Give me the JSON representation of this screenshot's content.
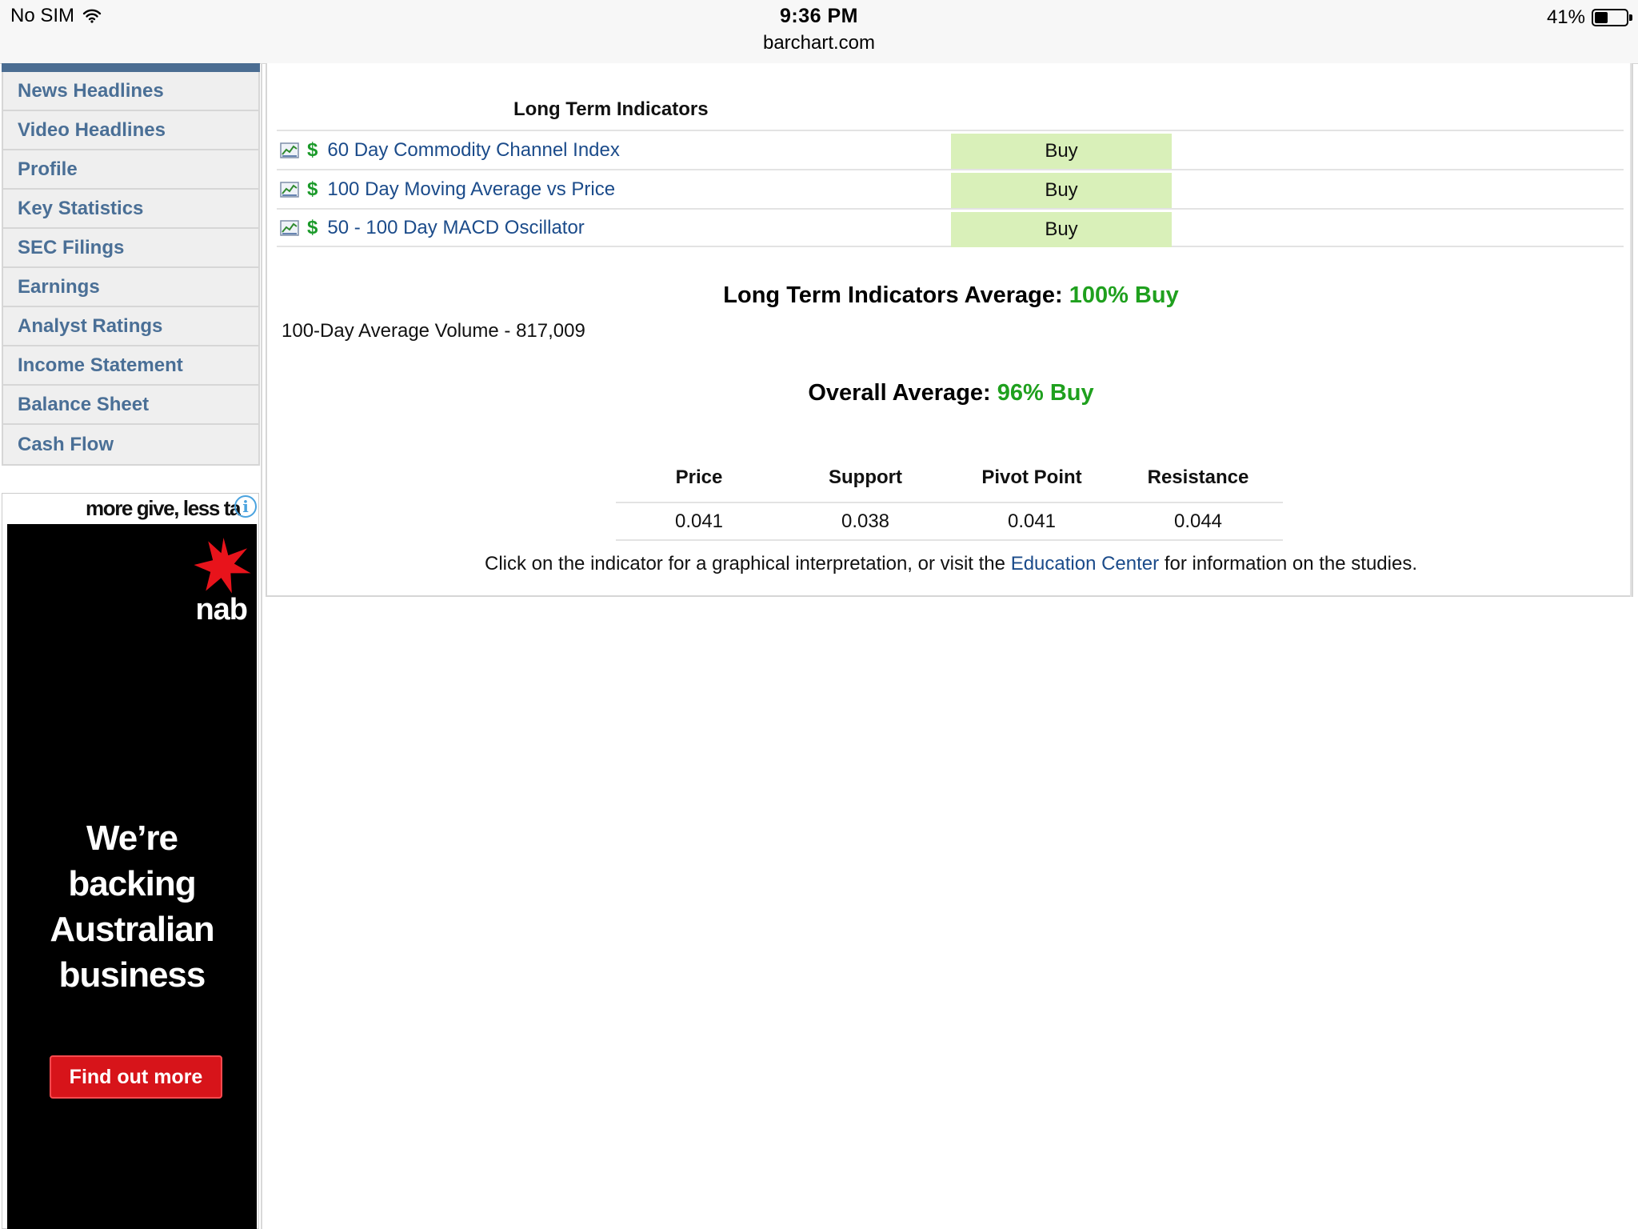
{
  "status_bar": {
    "carrier": "No SIM",
    "time": "9:36 PM",
    "url": "barchart.com",
    "battery": "41%",
    "battery_level": 0.41
  },
  "sidebar": {
    "items": [
      {
        "label": "News Headlines"
      },
      {
        "label": "Video Headlines"
      },
      {
        "label": "Profile"
      },
      {
        "label": "Key Statistics"
      },
      {
        "label": "SEC Filings"
      },
      {
        "label": "Earnings"
      },
      {
        "label": "Analyst Ratings"
      },
      {
        "label": "Income Statement"
      },
      {
        "label": "Balance Sheet"
      },
      {
        "label": "Cash Flow"
      }
    ]
  },
  "ad": {
    "tagline": "more give, less ta",
    "brand": "nab",
    "headline_lines": [
      "We’re",
      "backing",
      "Australian",
      "business"
    ],
    "cta": "Find out more",
    "colors": {
      "background": "#000000",
      "cta": "#d7141a",
      "star": "#e8131b"
    }
  },
  "long_term": {
    "title": "Long Term Indicators",
    "indicators": [
      {
        "name": "60 Day Commodity Channel Index",
        "signal": "Buy"
      },
      {
        "name": "100 Day Moving Average vs Price",
        "signal": "Buy"
      },
      {
        "name": "50 - 100 Day MACD Oscillator",
        "signal": "Buy"
      }
    ],
    "average_label": "Long Term Indicators Average:",
    "average_value": "100% Buy",
    "volume_text": "100-Day Average Volume - 817,009"
  },
  "overall": {
    "label": "Overall Average:",
    "value": "96% Buy"
  },
  "pivot_table": {
    "headers": [
      "Price",
      "Support",
      "Pivot Point",
      "Resistance"
    ],
    "values": [
      "0.041",
      "0.038",
      "0.041",
      "0.044"
    ]
  },
  "footnote": {
    "before": "Click on the indicator for a graphical interpretation, or visit the",
    "link": "Education Center",
    "after": "for information on the studies."
  },
  "colors": {
    "link": "#1b4b8a",
    "nav_text": "#4a6f96",
    "buy_bg": "#d9f0b9",
    "positive": "#1fa01e",
    "dollar_icon": "#1b9a2a"
  }
}
